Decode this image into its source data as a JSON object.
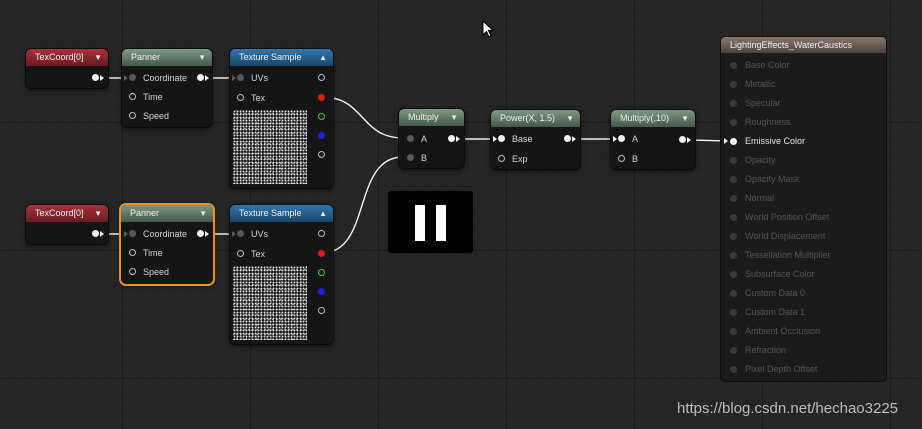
{
  "nodes": {
    "texcoord_top": {
      "title": "TexCoord[0]"
    },
    "panner_top": {
      "title": "Panner",
      "pins": [
        "Coordinate",
        "Time",
        "Speed"
      ]
    },
    "texsample_top": {
      "title": "Texture Sample",
      "pins": [
        "UVs",
        "Tex"
      ]
    },
    "texcoord_bottom": {
      "title": "TexCoord[0]"
    },
    "panner_bottom": {
      "title": "Panner",
      "pins": [
        "Coordinate",
        "Time",
        "Speed"
      ]
    },
    "texsample_bottom": {
      "title": "Texture Sample",
      "pins": [
        "UVs",
        "Tex"
      ]
    },
    "multiply": {
      "title": "Multiply",
      "pins": [
        "A",
        "B"
      ]
    },
    "power": {
      "title": "Power(X, 1.5)",
      "pins": [
        "Base",
        "Exp"
      ]
    },
    "multiply_10": {
      "title": "Multiply(,10)",
      "pins": [
        "A",
        "B"
      ]
    }
  },
  "material": {
    "title": "LightingEffects_WaterCaustics",
    "inputs": [
      "Base Color",
      "Metallic",
      "Specular",
      "Roughness",
      "Emissive Color",
      "Opacity",
      "Opacity Mask",
      "Normal",
      "World Position Offset",
      "World Displacement",
      "Tessellation Multiplier",
      "Subsurface Color",
      "Custom Data 0",
      "Custom Data 1",
      "Ambient Occlusion",
      "Refraction",
      "Pixel Depth Offset"
    ],
    "active_input": "Emissive Color"
  },
  "colors": {
    "selection_outline": "#e8941c",
    "header_texcoord": "#a8323a",
    "header_math": "#7d9a80",
    "header_texture": "#2f77b0",
    "header_material": "#8b786c"
  },
  "overlay": {
    "icon": "pause-icon"
  },
  "watermark": "https://blog.csdn.net/hechao3225"
}
